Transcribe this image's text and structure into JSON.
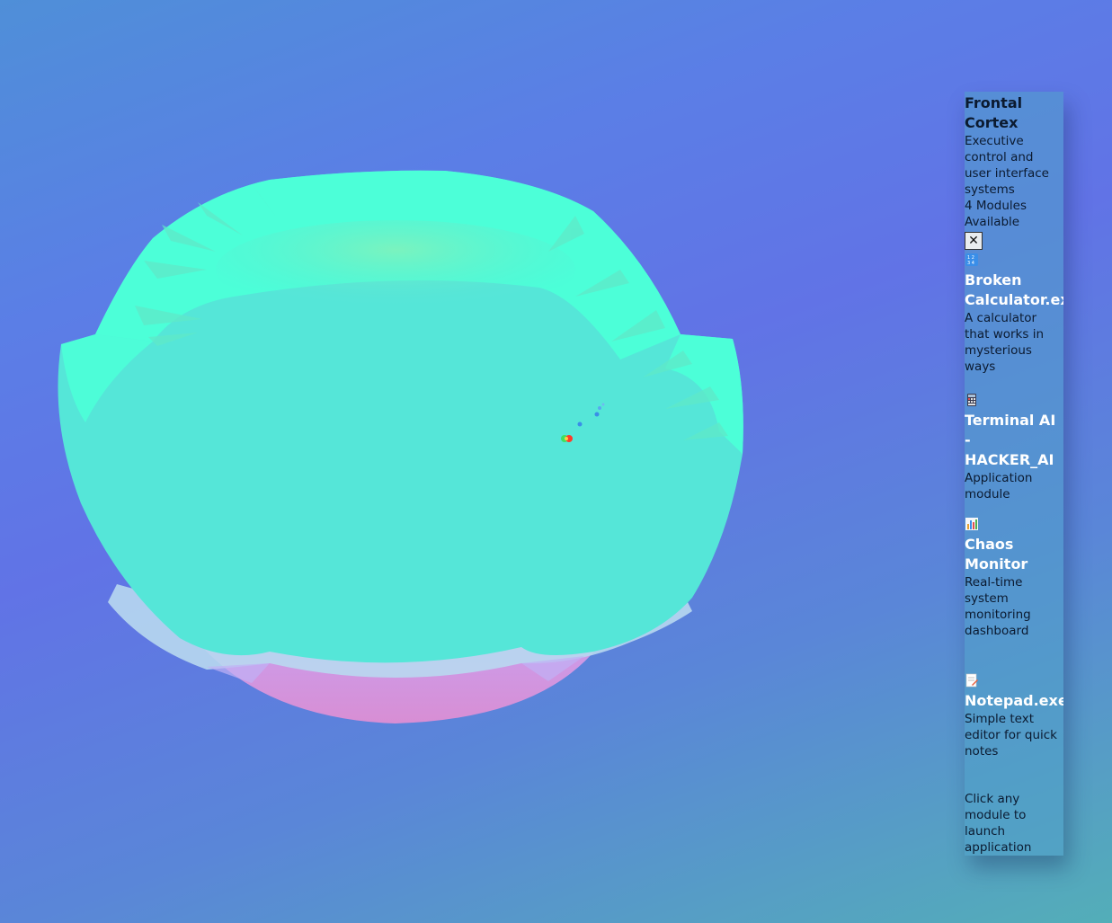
{
  "panel": {
    "title": "Frontal Cortex",
    "description": "Executive control and user interface systems",
    "module_count": "4 Modules Available",
    "close_label": "✕",
    "hint": "Click any module to launch application"
  },
  "modules": [
    {
      "icon": "calculator-icon",
      "name": "Broken Calculator.exe",
      "description": "A calculator that works in mysterious ways"
    },
    {
      "icon": "terminal-icon",
      "name": "Terminal AI - HACKER_AI",
      "description": "Application module"
    },
    {
      "icon": "bar-chart-icon",
      "name": "Chaos Monitor",
      "description": "Real-time system monitoring dashboard"
    },
    {
      "icon": "notepad-icon",
      "name": "Notepad.exe",
      "description": "Simple text editor for quick notes"
    }
  ],
  "colors": {
    "brain_surface": "#55e6d8",
    "brain_rim": "#4cffd8",
    "brain_underside": "#d892d8",
    "panel_bg": "#50a0c8"
  }
}
